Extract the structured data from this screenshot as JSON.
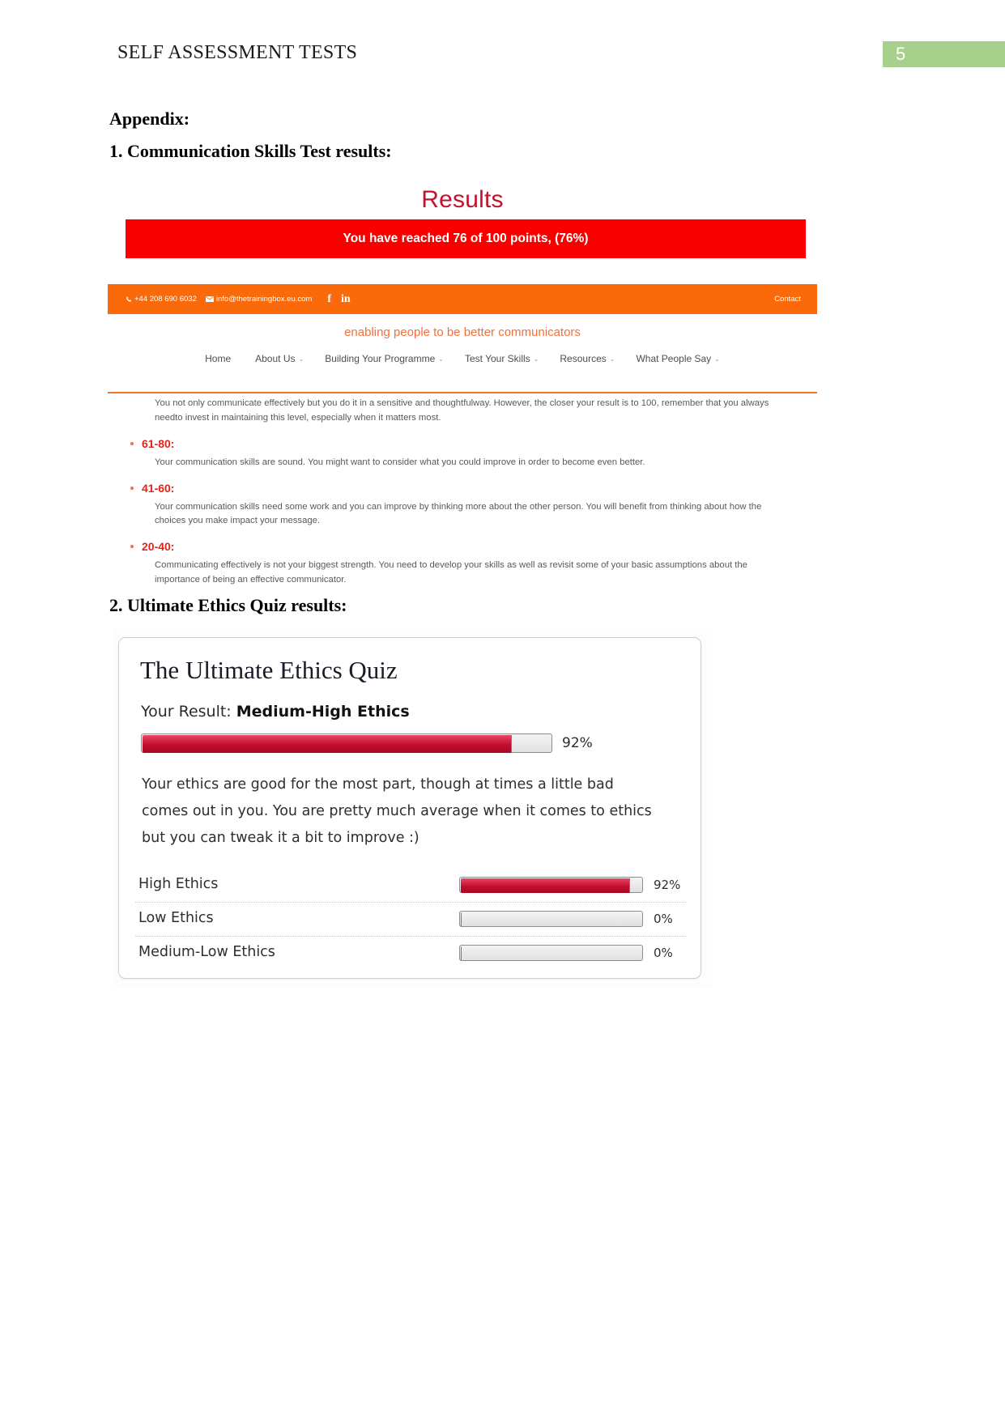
{
  "header": {
    "title": "SELF ASSESSMENT TESTS",
    "page_number": "5",
    "badge_color": "#a8d08d"
  },
  "document": {
    "appendix_heading": "Appendix:",
    "section1_heading": "1. Communication Skills Test results:",
    "section2_heading": "2. Ultimate Ethics Quiz results:"
  },
  "comm_test": {
    "results_title": "Results",
    "results_title_color": "#c3122d",
    "score_banner": "You have reached 76 of 100 points, (76%)",
    "banner_color": "#f90000",
    "topbar": {
      "phone": "+44 208 690 6032",
      "email": "info@thetrainingbox.eu.com",
      "facebook": "f",
      "linkedin": "in",
      "contact_label": "Contact",
      "background": "#fa6a0a"
    },
    "tagline": "enabling people to be better communicators",
    "nav": [
      {
        "label": "Home",
        "caret": ""
      },
      {
        "label": "About Us",
        "caret": "⌄"
      },
      {
        "label": "Building Your Programme",
        "caret": "⌄"
      },
      {
        "label": "Test Your Skills",
        "caret": "⌄"
      },
      {
        "label": "Resources",
        "caret": "⌄"
      },
      {
        "label": "What People Say",
        "caret": "⌄"
      }
    ],
    "intro_paragraph": "You not only communicate effectively but you do it in a sensitive and thoughtfulway. However, the closer your result is to 100, remember that you always needto invest in maintaining this level, especially when it matters most.",
    "ranges": [
      {
        "label": "61-80:",
        "text": "Your communication skills are sound. You might want to consider what you could improve in order to become even better."
      },
      {
        "label": "41-60:",
        "text": "Your communication skills need some work and you can improve by thinking more about the other person. You will benefit from thinking about how the choices you make impact your message."
      },
      {
        "label": "20-40:",
        "text": "Communicating effectively is not your biggest strength. You need to develop your skills as well as revisit some of your basic assumptions about the importance of being an effective communicator."
      }
    ]
  },
  "ethics_quiz": {
    "title": "The Ultimate Ethics Quiz",
    "result_prefix": "Your Result: ",
    "result_value": "Medium-High Ethics",
    "main_score": "92%",
    "main_score_value": 92,
    "description": "Your ethics are good for the most part, though at times a little bad comes out in you. You are pretty much average when it comes to ethics but you can tweak it a bit to improve :)",
    "bar_color": "#c30d2e",
    "breakdown": [
      {
        "label": "High Ethics",
        "pct": "92%",
        "value": 92
      },
      {
        "label": "Low Ethics",
        "pct": "0%",
        "value": 0
      },
      {
        "label": "Medium-Low Ethics",
        "pct": "0%",
        "value": 0
      }
    ]
  }
}
